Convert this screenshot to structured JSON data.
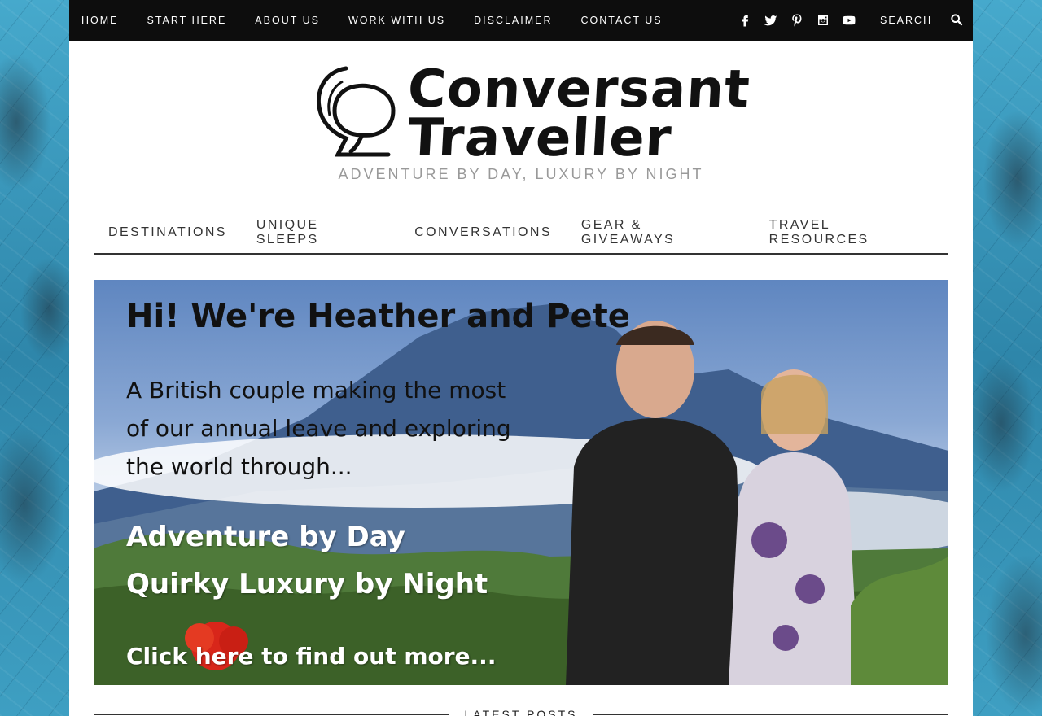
{
  "topbar": {
    "nav": [
      "HOME",
      "START HERE",
      "ABOUT US",
      "WORK WITH US",
      "DISCLAIMER",
      "CONTACT US"
    ],
    "social": [
      "facebook-icon",
      "twitter-icon",
      "pinterest-icon",
      "instagram-icon",
      "youtube-icon"
    ],
    "search_placeholder": "SEARCH"
  },
  "logo": {
    "line1": "Conversant",
    "line2": "Traveller",
    "tagline": "ADVENTURE BY DAY, LUXURY BY NIGHT"
  },
  "mainnav": [
    "DESTINATIONS",
    "UNIQUE SLEEPS",
    "CONVERSATIONS",
    "GEAR & GIVEAWAYS",
    "TRAVEL RESOURCES"
  ],
  "hero": {
    "heading": "Hi! We're Heather and Pete",
    "intro": "A British couple making the most of our annual leave and exploring the world through...",
    "line1": "Adventure by Day",
    "line2": "Quirky Luxury by Night",
    "cta": "Click here to find out more..."
  },
  "latest": {
    "label": "LATEST POSTS"
  }
}
